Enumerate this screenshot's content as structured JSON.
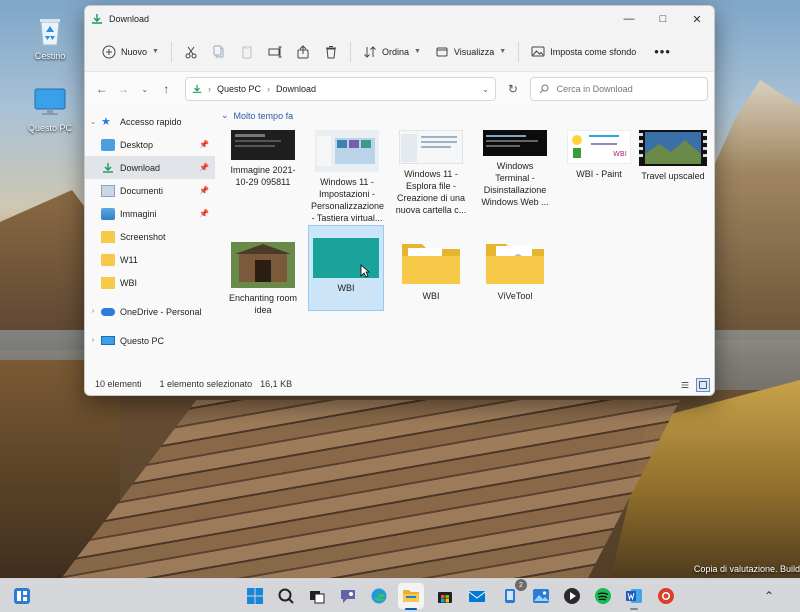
{
  "desktop": {
    "icons": [
      {
        "label": "Cestino"
      },
      {
        "label": "Questo PC"
      }
    ],
    "watermark": "Copia di valutazione. Build"
  },
  "window": {
    "title": "Download",
    "toolbar": {
      "new_label": "Nuovo",
      "sort_label": "Ordina",
      "view_label": "Visualizza",
      "wallpaper_label": "Imposta come sfondo"
    },
    "address": {
      "crumbs": [
        "Questo PC",
        "Download"
      ],
      "search_placeholder": "Cerca in Download"
    },
    "sidebar": {
      "quick_access": "Accesso rapido",
      "items": [
        {
          "label": "Desktop",
          "icon": "desktop-folder-icon",
          "pinned": true
        },
        {
          "label": "Download",
          "icon": "download-folder-icon",
          "pinned": true,
          "selected": true
        },
        {
          "label": "Documenti",
          "icon": "documents-folder-icon",
          "pinned": true
        },
        {
          "label": "Immagini",
          "icon": "pictures-folder-icon",
          "pinned": true
        },
        {
          "label": "Screenshot",
          "icon": "folder-icon",
          "pinned": false
        },
        {
          "label": "W11",
          "icon": "folder-icon",
          "pinned": false
        },
        {
          "label": "WBI",
          "icon": "folder-icon",
          "pinned": false
        }
      ],
      "onedrive": "OneDrive - Personal",
      "this_pc": "Questo PC"
    },
    "group_header": "Molto tempo fa",
    "files": [
      {
        "label": "Immagine 2021-10-29 095811",
        "kind": "image"
      },
      {
        "label": "Windows 11 - Impostazioni - Personalizzazione - Tastiera virtual...",
        "kind": "image"
      },
      {
        "label": "Windows 11 - Esplora file - Creazione di una nuova cartella c...",
        "kind": "image"
      },
      {
        "label": "Windows Terminal - Disinstallazione Windows Web ...",
        "kind": "image"
      },
      {
        "label": "WBI - Paint",
        "kind": "image"
      },
      {
        "label": "Travel upscaled",
        "kind": "video"
      },
      {
        "label": "Enchanting room idea",
        "kind": "image"
      },
      {
        "label": "WBI",
        "kind": "image",
        "selected": true
      },
      {
        "label": "WBI",
        "kind": "folder"
      },
      {
        "label": "ViVeTool",
        "kind": "folder"
      }
    ],
    "status": {
      "count": "10 elementi",
      "selection": "1 elemento selezionato",
      "size": "16,1 KB"
    }
  },
  "taskbar": {
    "mail_badge": "2"
  },
  "colors": {
    "accent": "#005fb8",
    "selection": "#cce4f7",
    "folder": "#f7c948",
    "teal_thumb": "#1aa39a"
  }
}
